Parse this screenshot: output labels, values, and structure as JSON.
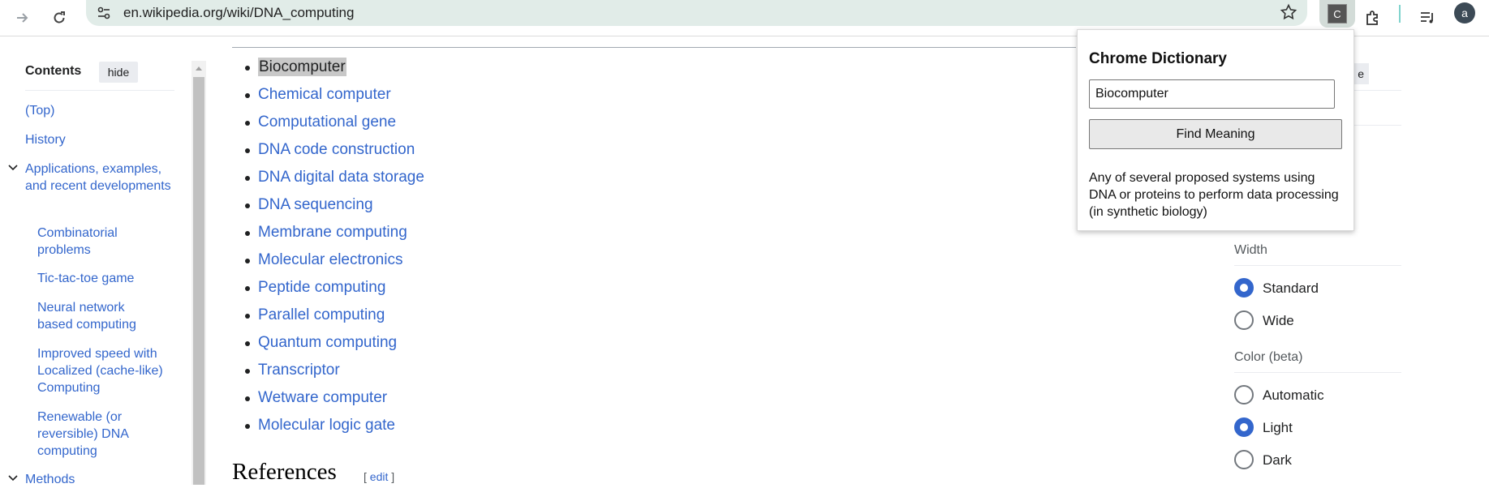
{
  "browser": {
    "url": "en.wikipedia.org/wiki/DNA_computing",
    "extension_letter": "C",
    "profile_initial": "a"
  },
  "toc": {
    "title": "Contents",
    "hide_label": "hide",
    "items": [
      {
        "label": "(Top)"
      },
      {
        "label": "History"
      },
      {
        "label": "Applications, examples, and recent developments"
      },
      {
        "label": "Combinatorial problems"
      },
      {
        "label": "Tic-tac-toe game"
      },
      {
        "label": "Neural network based computing"
      },
      {
        "label": "Improved speed with Localized (cache-like) Computing"
      },
      {
        "label": "Renewable (or reversible) DNA computing"
      },
      {
        "label": "Methods"
      }
    ]
  },
  "see_also": {
    "items": [
      "Biocomputer",
      "Chemical computer",
      "Computational gene",
      "DNA code construction",
      "DNA digital data storage",
      "DNA sequencing",
      "Membrane computing",
      "Molecular electronics",
      "Peptide computing",
      "Parallel computing",
      "Quantum computing",
      "Transcriptor",
      "Wetware computer",
      "Molecular logic gate"
    ]
  },
  "references": {
    "heading": "References",
    "edit_label": "edit",
    "bracket_open": "[",
    "bracket_close": "]"
  },
  "appearance": {
    "partial_button": "e",
    "width_label": "Width",
    "width_options": [
      {
        "label": "Standard",
        "checked": true
      },
      {
        "label": "Wide",
        "checked": false
      }
    ],
    "color_label": "Color (beta)",
    "color_options": [
      {
        "label": "Automatic",
        "checked": false
      },
      {
        "label": "Light",
        "checked": true
      },
      {
        "label": "Dark",
        "checked": false
      }
    ]
  },
  "dictionary_popup": {
    "title": "Chrome Dictionary",
    "input_value": "Biocomputer",
    "button_label": "Find Meaning",
    "definition": "Any of several proposed systems using DNA or proteins to perform data processing (in synthetic biology)"
  },
  "colors": {
    "link": "#3366cc",
    "accent": "#3366cc",
    "omnibox_bg": "#e1ece8"
  }
}
